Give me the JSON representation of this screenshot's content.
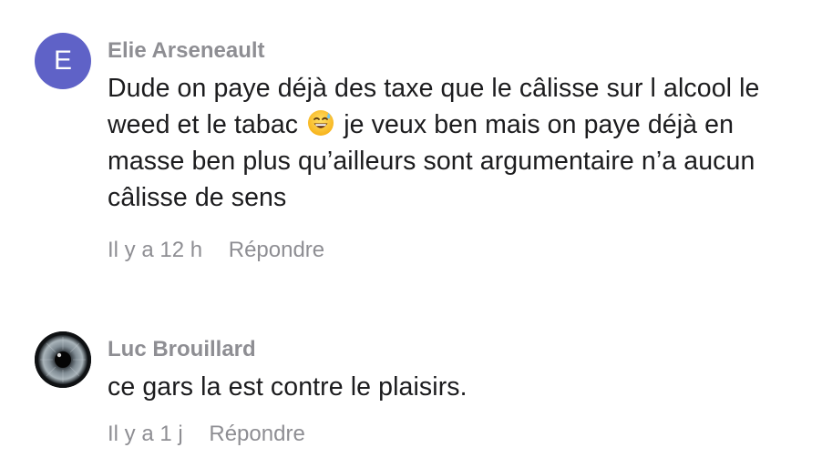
{
  "comments": [
    {
      "author": "Elie Arseneault",
      "avatar_letter": "E",
      "text_before_emoji": "Dude on paye déjà des taxe que le câlisse sur l alcool le weed et le tabac ",
      "emoji": "grinning-face-with-sweat",
      "text_after_emoji": " je veux ben mais on paye déjà en masse ben plus qu’ailleurs sont argumentaire n’a aucun câlisse de sens",
      "time": "Il y a 12 h",
      "reply_label": "Répondre",
      "avatar_color": "#5f62c7"
    },
    {
      "author": "Luc Brouillard",
      "avatar_icon": "eye-iris-photo",
      "text": "ce gars la est contre le plaisirs.",
      "time": "Il y a 1 j",
      "reply_label": "Répondre"
    }
  ],
  "colors": {
    "secondary_text": "#8e8e93",
    "primary_text": "#1c1c1e",
    "background": "#ffffff"
  }
}
